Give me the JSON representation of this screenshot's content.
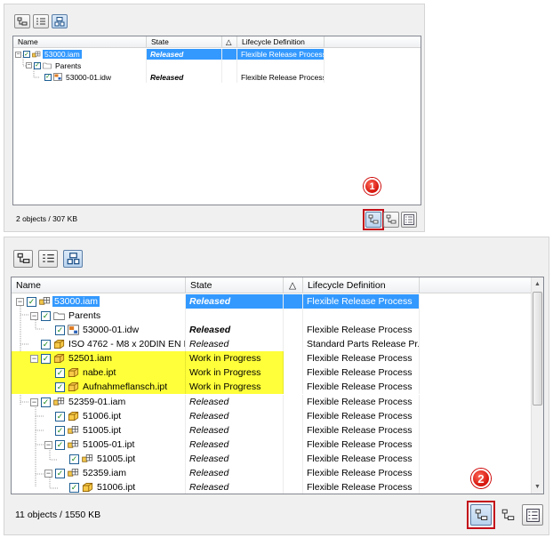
{
  "top_panel": {
    "columns": {
      "name": "Name",
      "state": "State",
      "sort": "△",
      "lifecycle": "Lifecycle Definition"
    },
    "rows": [
      {
        "name": "53000.iam",
        "state": "Released",
        "lifecycle": "Flexible Release Process",
        "icon": "assembly-icon"
      },
      {
        "name": "Parents",
        "state": "",
        "lifecycle": "",
        "icon": "folder-icon"
      },
      {
        "name": "53000-01.idw",
        "state": "Released",
        "lifecycle": "Flexible Release Process",
        "icon": "drawing-icon"
      }
    ],
    "status": "2 objects / 307 KB",
    "badge": "1"
  },
  "bottom_panel": {
    "columns": {
      "name": "Name",
      "state": "State",
      "sort": "△",
      "lifecycle": "Lifecycle Definition"
    },
    "rows": [
      {
        "name": "53000.iam",
        "state": "Released",
        "lifecycle": "Flexible Release Process",
        "icon": "assembly-icon"
      },
      {
        "name": "Parents",
        "state": "",
        "lifecycle": "",
        "icon": "folder-icon"
      },
      {
        "name": "53000-01.idw",
        "state": "Released",
        "lifecycle": "Flexible Release Process",
        "icon": "drawing-icon"
      },
      {
        "name": "ISO 4762 - M8 x 20DIN EN I...",
        "state": "Released",
        "lifecycle": "Standard Parts Release Pr...",
        "icon": "part-icon"
      },
      {
        "name": "52501.iam",
        "state": "Work in Progress",
        "lifecycle": "Flexible Release Process",
        "icon": "assembly-yellow-icon"
      },
      {
        "name": "nabe.ipt",
        "state": "Work in Progress",
        "lifecycle": "Flexible Release Process",
        "icon": "part-icon"
      },
      {
        "name": "Aufnahmeflansch.ipt",
        "state": "Work in Progress",
        "lifecycle": "Flexible Release Process",
        "icon": "part-icon"
      },
      {
        "name": "52359-01.iam",
        "state": "Released",
        "lifecycle": "Flexible Release Process",
        "icon": "assembly-icon"
      },
      {
        "name": "51006.ipt",
        "state": "Released",
        "lifecycle": "Flexible Release Process",
        "icon": "part-icon"
      },
      {
        "name": "51005.ipt",
        "state": "Released",
        "lifecycle": "Flexible Release Process",
        "icon": "assembly-icon"
      },
      {
        "name": "51005-01.ipt",
        "state": "Released",
        "lifecycle": "Flexible Release Process",
        "icon": "assembly-icon"
      },
      {
        "name": "51005.ipt",
        "state": "Released",
        "lifecycle": "Flexible Release Process",
        "icon": "assembly-icon"
      },
      {
        "name": "52359.iam",
        "state": "Released",
        "lifecycle": "Flexible Release Process",
        "icon": "assembly-icon"
      },
      {
        "name": "51006.ipt",
        "state": "Released",
        "lifecycle": "Flexible Release Process",
        "icon": "part-icon"
      }
    ],
    "status": "11 objects / 1550 KB",
    "badge": "2"
  },
  "colors": {
    "selection": "#3399ff",
    "highlight": "#ffff3a",
    "callout": "#d4120a"
  }
}
